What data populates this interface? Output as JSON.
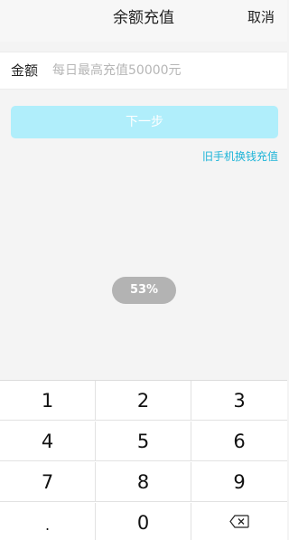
{
  "header": {
    "title": "余额充值",
    "cancel_label": "取消"
  },
  "amount": {
    "label": "金额",
    "placeholder": "每日最高充值50000元"
  },
  "next_button": {
    "label": "下一步"
  },
  "old_phone_link": {
    "label": "旧手机换钱充值"
  },
  "toast": {
    "text": "53%"
  },
  "keypad": {
    "keys": [
      "1",
      "2",
      "3",
      "4",
      "5",
      "6",
      "7",
      "8",
      "9",
      ".",
      "0"
    ],
    "backspace_icon": "backspace-icon"
  },
  "colors": {
    "accent": "#1db4d8",
    "button_disabled": "#b0eefb",
    "toast_bg": "#b3b3b3"
  }
}
